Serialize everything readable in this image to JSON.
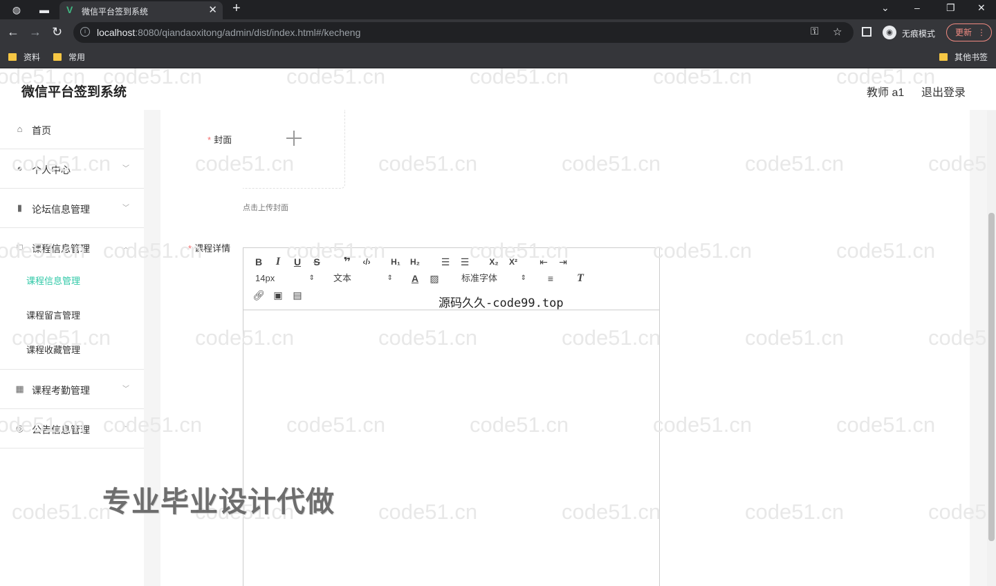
{
  "browser": {
    "tab_title": "微信平台签到系统",
    "tab_favicon": "V",
    "url_host": "localhost",
    "url_rest": ":8080/qiandaoxitong/admin/dist/index.html#/kecheng",
    "incognito_label": "无痕模式",
    "update_label": "更新",
    "bookmarks": [
      "资料",
      "常用"
    ],
    "other_bookmarks": "其他书签"
  },
  "header": {
    "title": "微信平台签到系统",
    "user": "教师 a1",
    "logout": "退出登录"
  },
  "sidebar": {
    "items": [
      {
        "label": "首页",
        "icon": "home-icon"
      },
      {
        "label": "个人中心",
        "icon": "user-icon"
      },
      {
        "label": "论坛信息管理",
        "icon": "book-icon"
      },
      {
        "label": "课程信息管理",
        "icon": "box-icon"
      },
      {
        "label": "课程考勤管理",
        "icon": "grid-icon"
      },
      {
        "label": "公告信息管理",
        "icon": "compass-icon"
      }
    ],
    "sub_items": [
      "课程信息管理",
      "课程留言管理",
      "课程收藏管理"
    ]
  },
  "form": {
    "cover_label": "封面",
    "upload_tip": "点击上传封面",
    "detail_label": "课程详情"
  },
  "editor": {
    "size_value": "14px",
    "header_value": "文本",
    "font_value": "标准字体"
  },
  "overlays": {
    "source_watermark": "源码久久-code99.top",
    "promo_watermark": "专业毕业设计代做",
    "tile_watermark": "code51.cn"
  }
}
